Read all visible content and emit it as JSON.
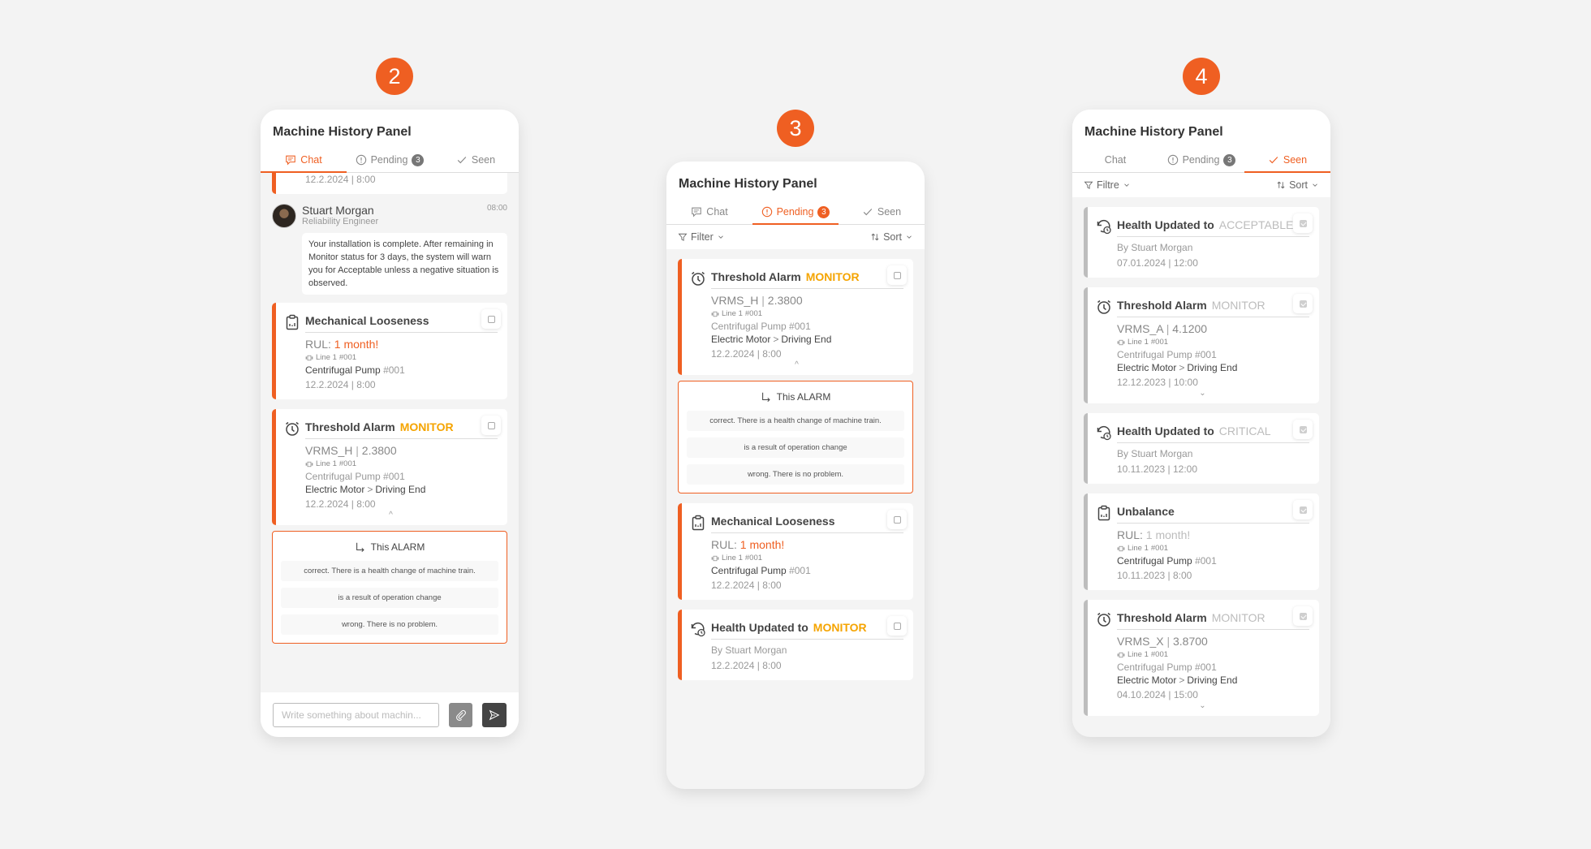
{
  "steps": [
    "2",
    "3",
    "4"
  ],
  "panel_title": "Machine History Panel",
  "tabs": {
    "chat": "Chat",
    "pending": "Pending",
    "pending_count": "3",
    "seen": "Seen"
  },
  "colors": {
    "accent": "#ef5f22",
    "monitor": "#f5a400",
    "seen_status": "#bcbcbc"
  },
  "panel2": {
    "top_partial_date": "12.2.2024 | 8:00",
    "message": {
      "name": "Stuart Morgan",
      "role": "Reliability Engineer",
      "time": "08:00",
      "text": "Your installation is complete. After remaining in Monitor status for 3 days, the system will warn you for Acceptable unless a negative situation is observed."
    },
    "cards": [
      {
        "title": "Mechanical Looseness",
        "rul_label": "RUL:",
        "rul_value": "1 month!",
        "line": "Line 1",
        "line_num": "#001",
        "machine": "Centrifugal Pump",
        "machine_num": "#001",
        "date": "12.2.2024",
        "time": "8:00"
      },
      {
        "title": "Threshold Alarm",
        "status": "MONITOR",
        "metric": "VRMS_H",
        "value": "2.3800",
        "line": "Line 1",
        "line_num": "#001",
        "machine": "Centrifugal Pump #001",
        "component": "Electric Motor",
        "part": "Driving End",
        "date": "12.2.2024",
        "time": "8:00",
        "chevron": "^"
      }
    ],
    "feedback": {
      "title": "This ALARM",
      "options": [
        "correct. There is a health change of machine train.",
        "is a result of operation change",
        "wrong. There is no problem."
      ]
    },
    "input_placeholder": "Write something about machin..."
  },
  "panel3": {
    "filter_label": "Filter",
    "sort_label": "Sort",
    "cards": [
      {
        "title": "Threshold Alarm",
        "status": "MONITOR",
        "metric": "VRMS_H",
        "value": "2.3800",
        "line": "Line 1",
        "line_num": "#001",
        "machine": "Centrifugal Pump #001",
        "component": "Electric Motor",
        "part": "Driving End",
        "date": "12.2.2024",
        "time": "8:00",
        "chevron": "^"
      },
      {
        "title": "Mechanical Looseness",
        "rul_label": "RUL:",
        "rul_value": "1 month!",
        "line": "Line 1",
        "line_num": "#001",
        "machine": "Centrifugal Pump",
        "machine_num": "#001",
        "date": "12.2.2024",
        "time": "8:00"
      },
      {
        "title": "Health Updated to",
        "status": "MONITOR",
        "by": "By Stuart Morgan",
        "date": "12.2.2024",
        "time": "8:00"
      }
    ],
    "feedback": {
      "title": "This ALARM",
      "options": [
        "correct. There is a health change of machine train.",
        "is a result of operation change",
        "wrong. There is no problem."
      ]
    }
  },
  "panel4": {
    "filter_label": "Filtre",
    "sort_label": "Sort",
    "cards": [
      {
        "title": "Health Updated to",
        "status": "ACCEPTABLE",
        "by": "By Stuart Morgan",
        "date": "07.01.2024",
        "time": "12:00"
      },
      {
        "title": "Threshold Alarm",
        "status": "MONITOR",
        "metric": "VRMS_A",
        "value": "4.1200",
        "line": "Line 1",
        "line_num": "#001",
        "machine": "Centrifugal Pump #001",
        "component": "Electric Motor",
        "part": "Driving End",
        "date": "12.12.2023",
        "time": "10:00",
        "chevron": "⌄"
      },
      {
        "title": "Health Updated to",
        "status": "CRITICAL",
        "by": "By Stuart Morgan",
        "date": "10.11.2023",
        "time": "12:00"
      },
      {
        "title": "Unbalance",
        "rul_label": "RUL:",
        "rul_value": "1 month!",
        "line": "Line 1",
        "line_num": "#001",
        "machine": "Centrifugal Pump",
        "machine_num": "#001",
        "date": "10.11.2023",
        "time": "8:00"
      },
      {
        "title": "Threshold Alarm",
        "status": "MONITOR",
        "metric": "VRMS_X",
        "value": "3.8700",
        "line": "Line 1",
        "line_num": "#001",
        "machine": "Centrifugal Pump #001",
        "component": "Electric Motor",
        "part": "Driving End",
        "date": "04.10.2024",
        "time": "15:00",
        "chevron": "⌄"
      }
    ]
  }
}
